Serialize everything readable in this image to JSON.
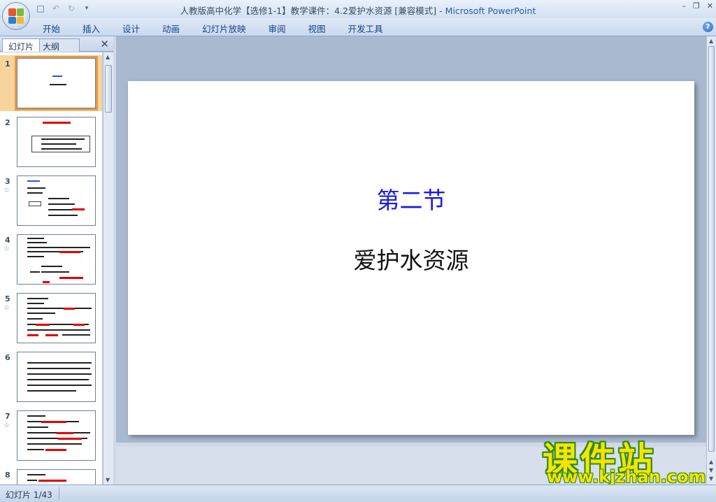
{
  "window": {
    "title": "人教版高中化学【选修1-1】教学课件：4.2爱护水资源 [兼容模式]",
    "app_name": "- Microsoft PowerPoint"
  },
  "ribbon": {
    "tabs": [
      "开始",
      "插入",
      "设计",
      "动画",
      "幻灯片放映",
      "审阅",
      "视图",
      "开发工具"
    ]
  },
  "left_pane": {
    "tabs": {
      "slides": "幻灯片",
      "outline": "大纲"
    },
    "close": "✕",
    "thumbnails": [
      {
        "number": "1",
        "anim": ""
      },
      {
        "number": "2",
        "anim": ""
      },
      {
        "number": "3",
        "anim": "☆"
      },
      {
        "number": "4",
        "anim": "☆"
      },
      {
        "number": "5",
        "anim": "☆"
      },
      {
        "number": "6",
        "anim": ""
      },
      {
        "number": "7",
        "anim": "☆"
      },
      {
        "number": "8",
        "anim": ""
      }
    ]
  },
  "slide": {
    "title": "第二节",
    "subtitle": "爱护水资源",
    "title_color": "#1a1ae6"
  },
  "watermark": {
    "cn": "课件站",
    "url": "www.kjzhan.com"
  },
  "status": {
    "slide_counter": "幻灯片 1/43"
  }
}
